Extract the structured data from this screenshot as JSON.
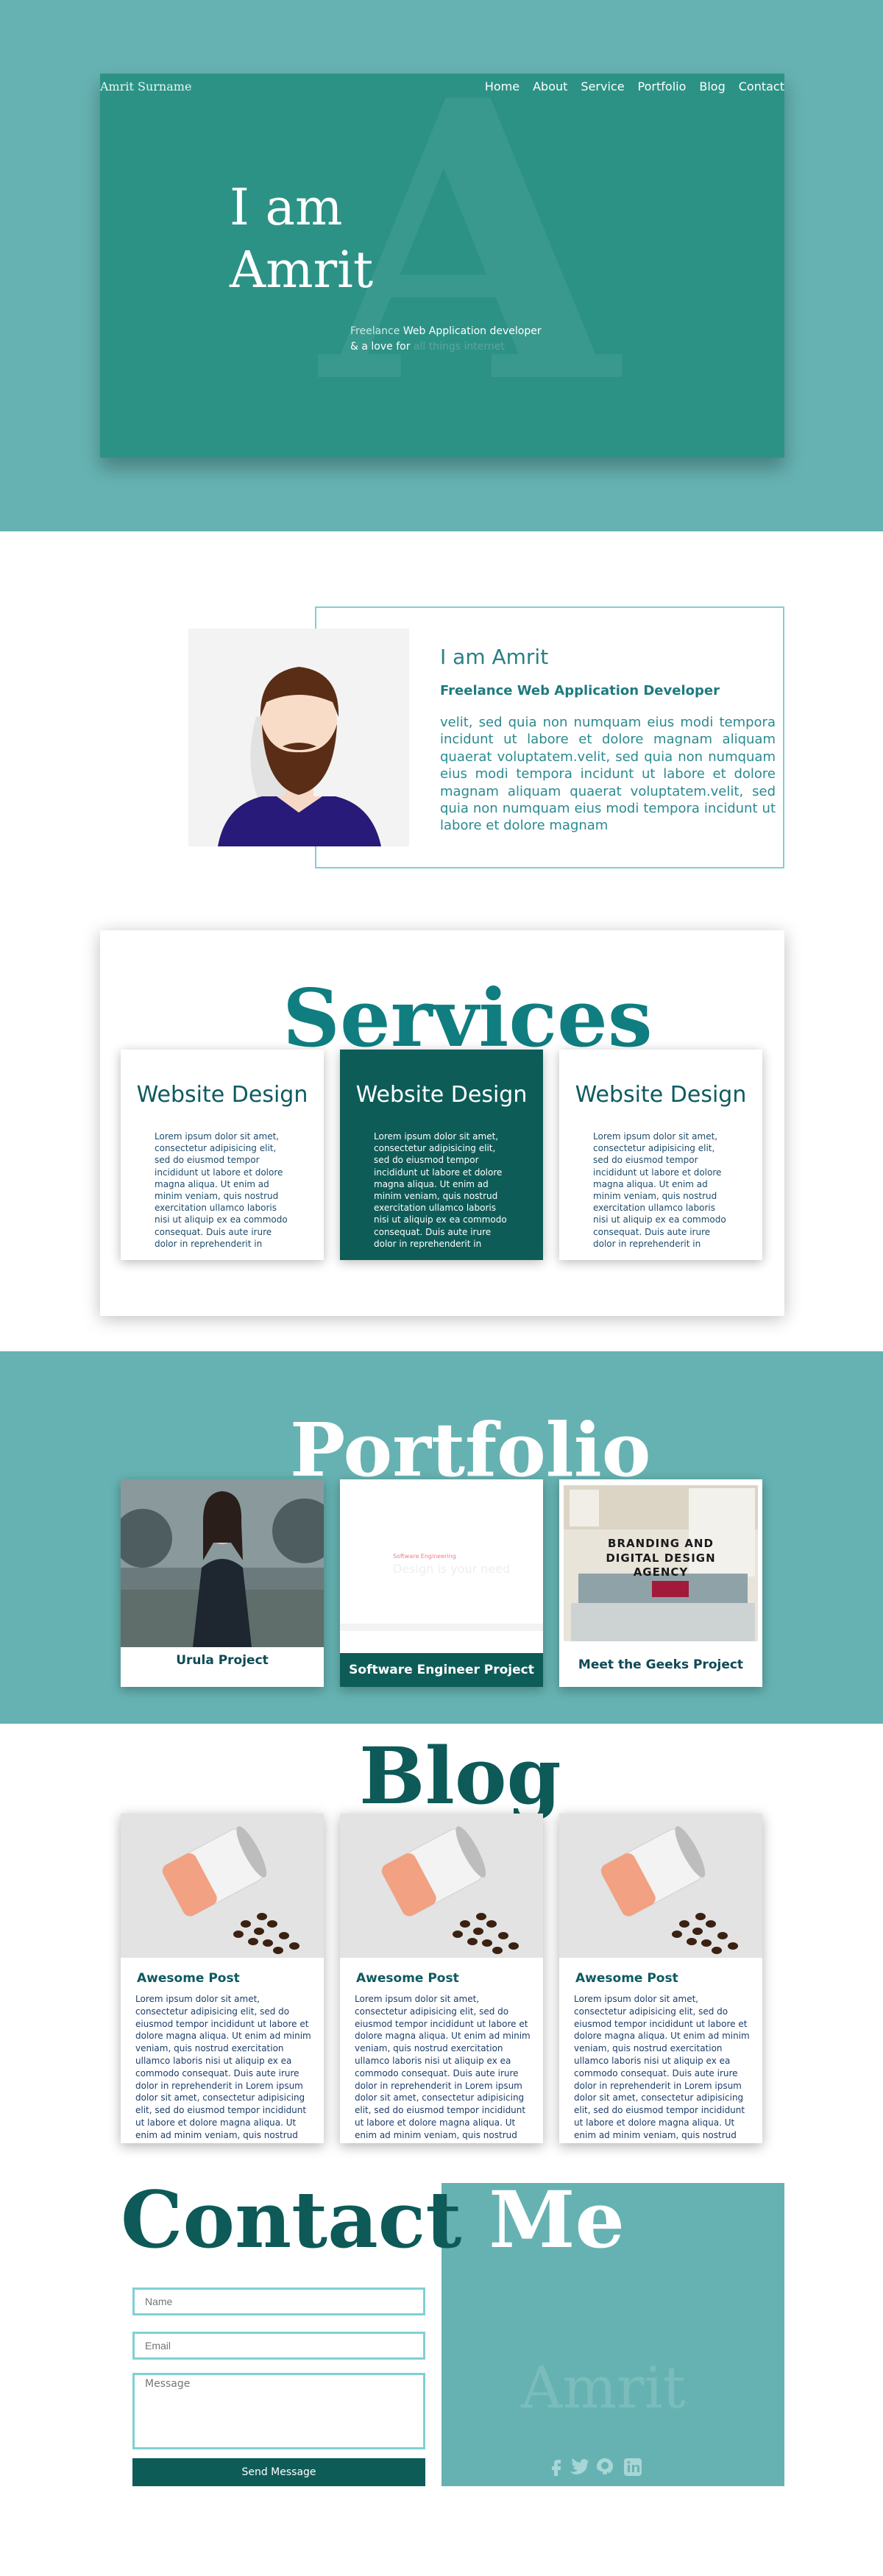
{
  "hero": {
    "brand": "Amrit Surname",
    "nav": [
      "Home",
      "About",
      "Service",
      "Portfolio",
      "Blog",
      "Contact"
    ],
    "watermark": "A",
    "title_line1": "I am",
    "title_line2": "Amrit",
    "sub_1a": "Freelance",
    "sub_1b": " Web Application developer",
    "sub_2a": "& a love for ",
    "sub_2b": "all things internet"
  },
  "about": {
    "name": "I am Amrit",
    "role": "Freelance Web Application Developer",
    "text": "velit, sed quia non numquam eius modi tempora incidunt ut labore et dolore magnam aliquam quaerat voluptatem.velit, sed quia non numquam eius modi tempora incidunt ut labore et dolore magnam aliquam quaerat voluptatem.velit, sed quia non numquam eius modi tempora incidunt ut labore et dolore magnam"
  },
  "services": {
    "title": "Services",
    "cards": [
      {
        "title": "Website Design",
        "text": "Lorem ipsum dolor sit amet, consectetur adipisicing elit, sed do eiusmod tempor incididunt ut labore et dolore magna aliqua. Ut enim ad minim veniam, quis nostrud exercitation ullamco laboris nisi ut aliquip ex ea commodo consequat. Duis aute irure dolor in reprehenderit in"
      },
      {
        "title": "Website Design",
        "text": "Lorem ipsum dolor sit amet, consectetur adipisicing elit, sed do eiusmod tempor incididunt ut labore et dolore magna aliqua. Ut enim ad minim veniam, quis nostrud exercitation ullamco laboris nisi ut aliquip ex ea commodo consequat. Duis aute irure dolor in reprehenderit in"
      },
      {
        "title": "Website Design",
        "text": "Lorem ipsum dolor sit amet, consectetur adipisicing elit, sed do eiusmod tempor incididunt ut labore et dolore magna aliqua. Ut enim ad minim veniam, quis nostrud exercitation ullamco laboris nisi ut aliquip ex ea commodo consequat. Duis aute irure dolor in reprehenderit in"
      }
    ]
  },
  "portfolio": {
    "title": "Portfolio",
    "items": [
      {
        "caption": "Urula Project"
      },
      {
        "caption": "Software Engineer Project",
        "thumb_small": "Software Engineering",
        "thumb_big": "Design is your need"
      },
      {
        "caption": "Meet the Geeks Project",
        "thumb_heading": "BRANDING AND DIGITAL DESIGN AGENCY"
      }
    ]
  },
  "blog": {
    "title": "Blog",
    "posts": [
      {
        "title": "Awesome Post",
        "text": "Lorem ipsum dolor sit amet, consectetur adipisicing elit, sed do eiusmod tempor incididunt ut labore et dolore magna aliqua. Ut enim ad minim veniam, quis nostrud exercitation ullamco laboris nisi ut aliquip ex ea commodo consequat. Duis aute irure dolor in reprehenderit in Lorem ipsum dolor sit amet, consectetur adipisicing elit, sed do eiusmod tempor incididunt ut labore et dolore magna aliqua. Ut enim ad minim veniam, quis nostrud exercitation ullamco laboris nisi"
      },
      {
        "title": "Awesome Post",
        "text": "Lorem ipsum dolor sit amet, consectetur adipisicing elit, sed do eiusmod tempor incididunt ut labore et dolore magna aliqua. Ut enim ad minim veniam, quis nostrud exercitation ullamco laboris nisi ut aliquip ex ea commodo consequat. Duis aute irure dolor in reprehenderit in Lorem ipsum dolor sit amet, consectetur adipisicing elit, sed do eiusmod tempor incididunt ut labore et dolore magna aliqua. Ut enim ad minim veniam, quis nostrud exercitation ullamco laboris nisi"
      },
      {
        "title": "Awesome Post",
        "text": "Lorem ipsum dolor sit amet, consectetur adipisicing elit, sed do eiusmod tempor incididunt ut labore et dolore magna aliqua. Ut enim ad minim veniam, quis nostrud exercitation ullamco laboris nisi ut aliquip ex ea commodo consequat. Duis aute irure dolor in reprehenderit in Lorem ipsum dolor sit amet, consectetur adipisicing elit, sed do eiusmod tempor incididunt ut labore et dolore magna aliqua. Ut enim ad minim veniam, quis nostrud exercitation ullamco laboris nisi"
      }
    ]
  },
  "contact": {
    "title_part1": "Contact ",
    "title_part2": "Me",
    "name_placeholder": "Name",
    "email_placeholder": "Email",
    "message_placeholder": "Message",
    "send_label": "Send Message",
    "watermark": "Amrit",
    "social_icons": [
      "facebook-icon",
      "twitter-icon",
      "github-icon",
      "linkedin-icon"
    ]
  },
  "colors": {
    "teal_light": "#66b2b2",
    "teal_hero": "#2c9286",
    "teal_dark": "#0e5c58",
    "accent_border": "#7fd0d4"
  }
}
